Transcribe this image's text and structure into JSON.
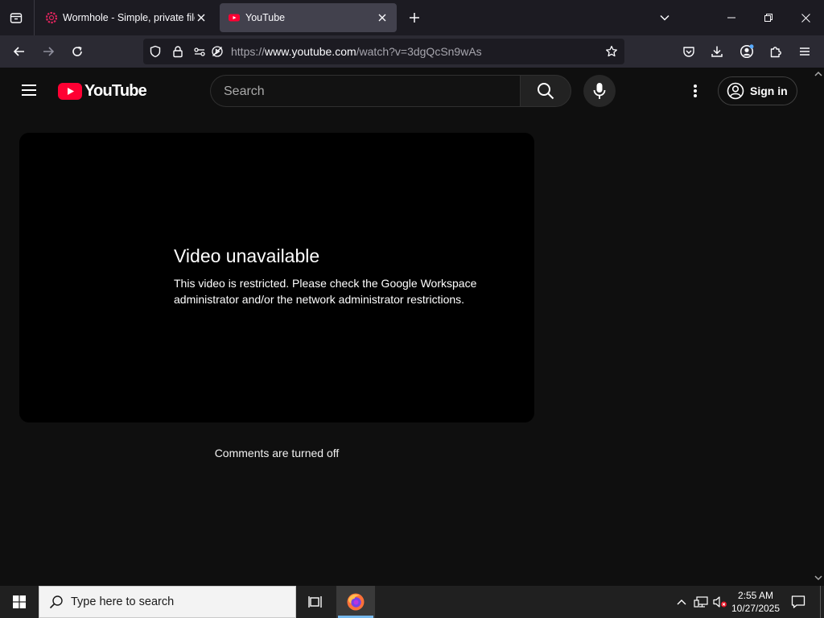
{
  "browser": {
    "tabs": [
      {
        "title": "Wormhole - Simple, private file",
        "active": false
      },
      {
        "title": "YouTube",
        "active": true
      }
    ],
    "url": {
      "scheme": "https://",
      "host": "www.youtube.com",
      "path": "/watch?v=3dgQcSn9wAs"
    }
  },
  "youtube": {
    "logo_text": "YouTube",
    "search_placeholder": "Search",
    "sign_in_label": "Sign in",
    "player": {
      "error_title": "Video unavailable",
      "error_message": "This video is restricted. Please check the Google Workspace administrator and/or the network administrator restrictions."
    },
    "comments_status": "Comments are turned off"
  },
  "taskbar": {
    "search_placeholder": "Type here to search",
    "time": "2:55 AM",
    "date": "10/27/2025"
  },
  "colors": {
    "youtube_red": "#ff0033",
    "page_bg": "#0f0f0f",
    "tab_active_bg": "#42414d",
    "accent_blue": "#76b9ed"
  }
}
